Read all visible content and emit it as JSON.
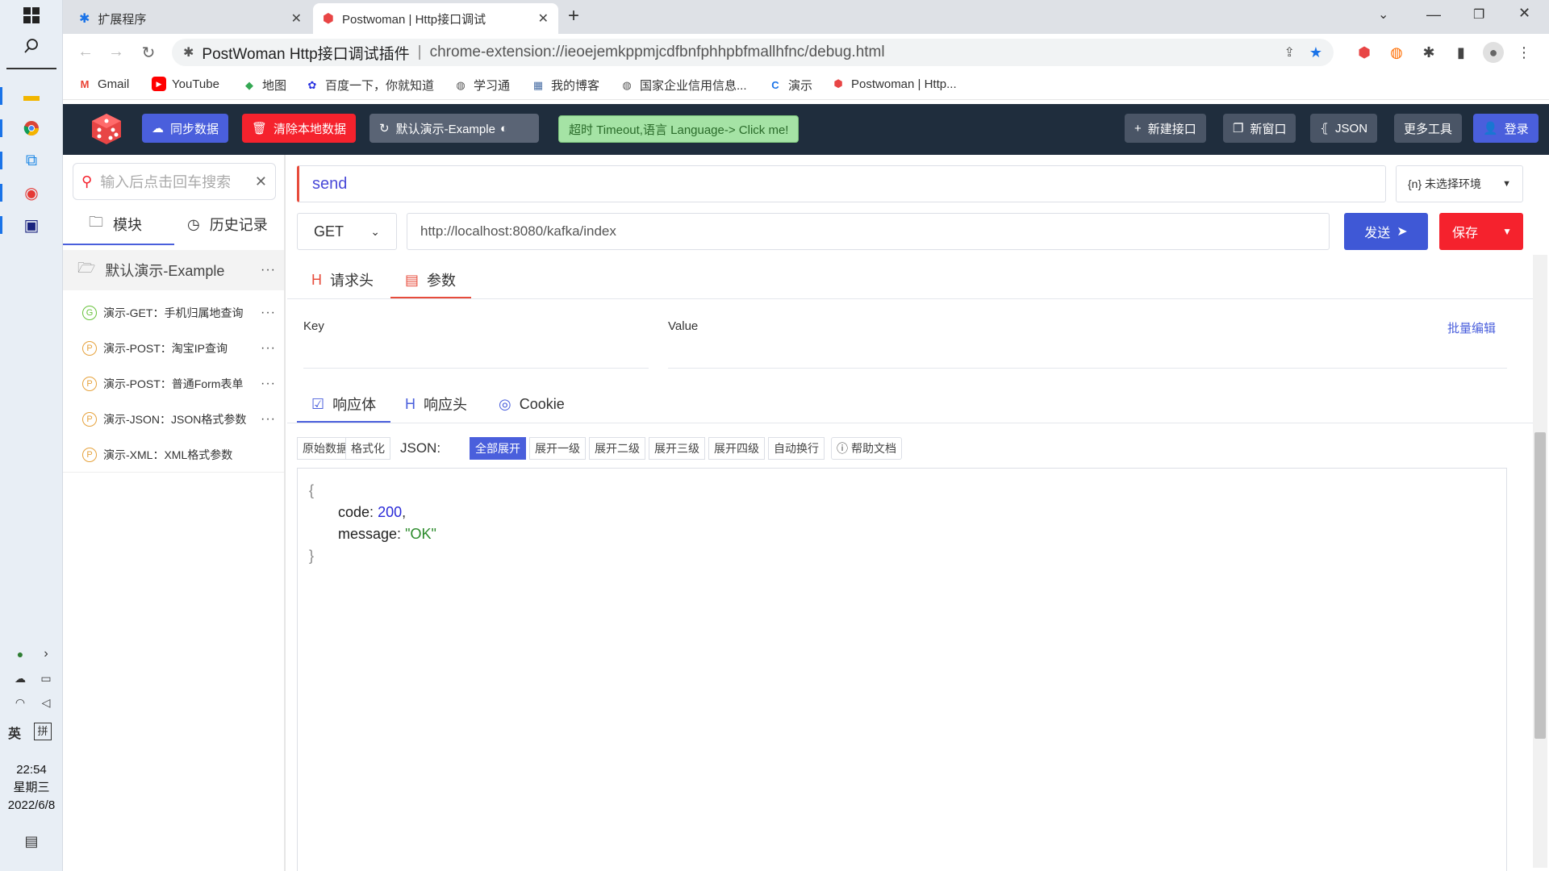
{
  "taskbar": {
    "time": "22:54",
    "weekday": "星期三",
    "date": "2022/6/8",
    "ime_lang": "英",
    "ime_mode": "拼"
  },
  "browser": {
    "tabs": [
      {
        "label": "扩展程序",
        "active": false
      },
      {
        "label": "Postwoman | Http接口调试",
        "active": true
      }
    ],
    "new_tab": "+",
    "omnibox": {
      "ext_name": "PostWoman Http接口调试插件",
      "separator": "|",
      "url": "chrome-extension://ieoejemkppmjcdfbnfphhpbfmallhfnc/debug.html"
    },
    "bookmarks": [
      {
        "label": "Gmail",
        "icon": "gmail-icon",
        "color": "#ea4335",
        "glyph": "M"
      },
      {
        "label": "YouTube",
        "icon": "youtube-icon",
        "color": "#ff0000",
        "glyph": "▶"
      },
      {
        "label": "地图",
        "icon": "maps-icon",
        "color": "#34a853",
        "glyph": "◆"
      },
      {
        "label": "百度一下，你就知道",
        "icon": "baidu-icon",
        "color": "#2932e1",
        "glyph": "✿"
      },
      {
        "label": "学习通",
        "icon": "globe-icon",
        "color": "#555555",
        "glyph": "◍"
      },
      {
        "label": "我的博客",
        "icon": "blog-icon",
        "color": "#4a6fa5",
        "glyph": "▦"
      },
      {
        "label": "国家企业信用信息...",
        "icon": "globe-icon",
        "color": "#555555",
        "glyph": "◍"
      },
      {
        "label": "演示",
        "icon": "demo-icon",
        "color": "#1a73e8",
        "glyph": "C"
      },
      {
        "label": "Postwoman | Http...",
        "icon": "postwoman-icon",
        "color": "#e84545",
        "glyph": "⬢"
      }
    ]
  },
  "header": {
    "sync_label": "同步数据",
    "clear_label": "清除本地数据",
    "demo_label": "默认演示-Example",
    "timeout_label": "超时 Timeout,语言 Language-> Click me!",
    "new_api_label": "新建接口",
    "new_window_label": "新窗口",
    "json_label": "JSON",
    "more_tools_label": "更多工具",
    "login_label": "登录"
  },
  "sidebar": {
    "search_placeholder": "输入后点击回车搜索",
    "tab_module": "模块",
    "tab_history": "历史记录",
    "folder": "默认演示-Example",
    "items": [
      {
        "method": "G",
        "label": "演示-GET：手机归属地查询",
        "color": "#67c23a"
      },
      {
        "method": "P",
        "label": "演示-POST：淘宝IP查询",
        "color": "#e6a23c"
      },
      {
        "method": "P",
        "label": "演示-POST：普通Form表单",
        "color": "#e6a23c"
      },
      {
        "method": "P",
        "label": "演示-JSON：JSON格式参数",
        "color": "#e6a23c"
      },
      {
        "method": "P",
        "label": "演示-XML：XML格式参数",
        "color": "#e6a23c"
      }
    ]
  },
  "request": {
    "name": "send",
    "env": "{n} 未选择环境",
    "method": "GET",
    "url": "http://localhost:8080/kafka/index",
    "send_label": "发送",
    "save_label": "保存",
    "tabs": [
      "请求头",
      "参数"
    ],
    "key_header": "Key",
    "value_header": "Value",
    "bulk_edit": "批量编辑"
  },
  "response": {
    "tabs": [
      "响应体",
      "响应头",
      "Cookie"
    ],
    "raw_label": "原始数据",
    "format_label": "格式化",
    "json_label": "JSON:",
    "expand_buttons": [
      "全部展开",
      "展开一级",
      "展开二级",
      "展开三级",
      "展开四级",
      "自动换行"
    ],
    "help_label": "帮助文档",
    "body": {
      "open": "{",
      "close": "}",
      "code_key": "code",
      "code_value": "200",
      "message_key": "message",
      "message_value": "\"OK\""
    }
  },
  "colors": {
    "header_bg": "#1f2d3d",
    "primary": "#3f58d6",
    "danger": "#f5222d",
    "active_tab": "#e74c3c"
  }
}
